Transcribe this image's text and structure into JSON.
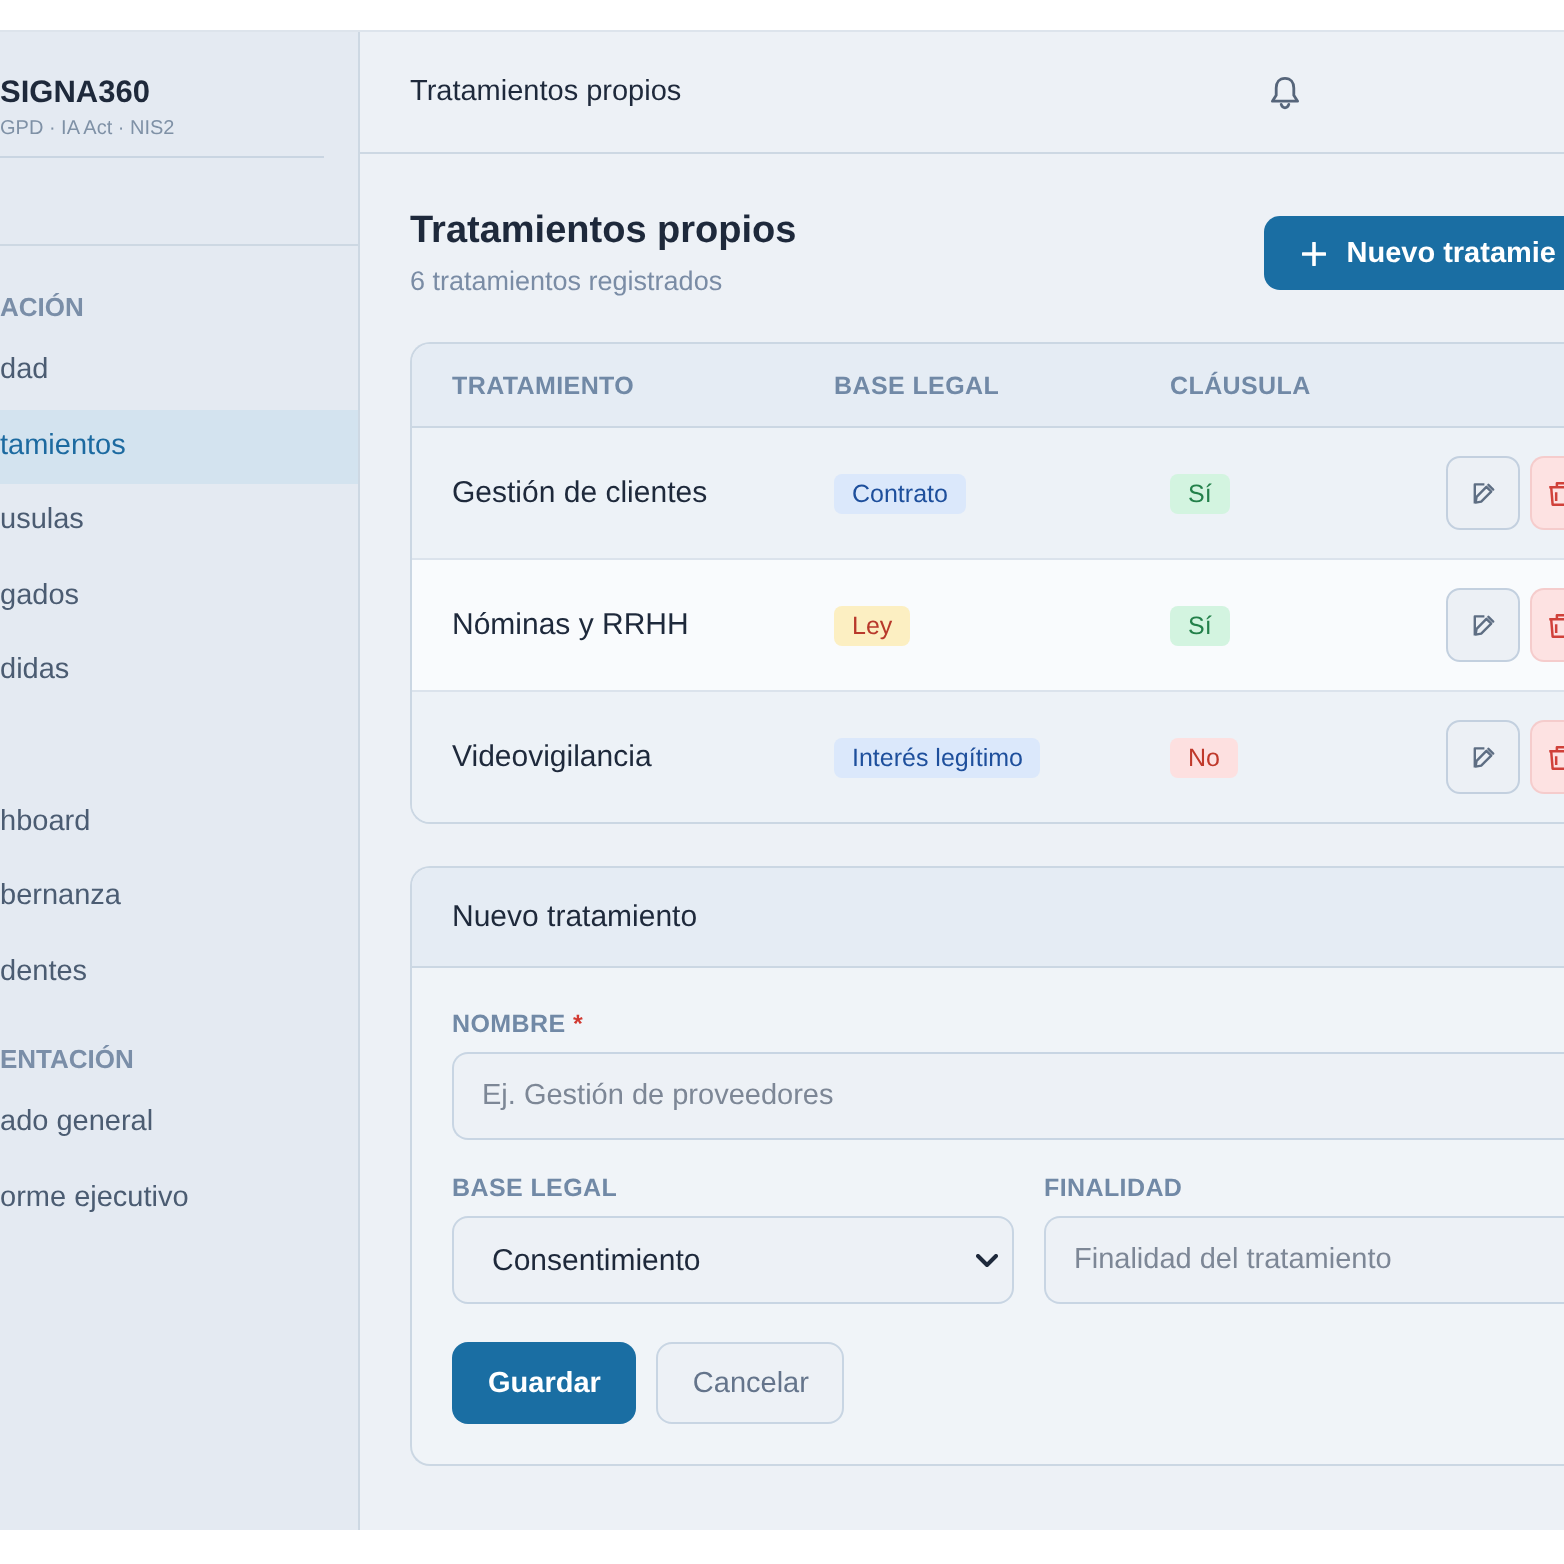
{
  "sidebar": {
    "brand": "SIGNA360",
    "tagline": "GPD · IA Act · NIS2",
    "sections": [
      {
        "title": "ACIÓN",
        "items": [
          {
            "label": "dad",
            "selected": false
          },
          {
            "label": "tamientos",
            "selected": true
          },
          {
            "label": "usulas",
            "selected": false
          },
          {
            "label": "gados",
            "selected": false
          },
          {
            "label": "didas",
            "selected": false
          }
        ]
      },
      {
        "items": [
          {
            "label": "hboard",
            "selected": false
          },
          {
            "label": "bernanza",
            "selected": false
          },
          {
            "label": "dentes",
            "selected": false
          }
        ]
      },
      {
        "title": "ENTACIÓN",
        "items": [
          {
            "label": "ado general",
            "selected": false
          },
          {
            "label": "orme ejecutivo",
            "selected": false
          }
        ]
      }
    ]
  },
  "topbar": {
    "title": "Tratamientos propios"
  },
  "page": {
    "title": "Tratamientos propios",
    "subtitle": "6 tratamientos registrados",
    "new_button": "Nuevo tratamie"
  },
  "table": {
    "columns": [
      "TRATAMIENTO",
      "BASE LEGAL",
      "CLÁUSULA"
    ],
    "rows": [
      {
        "name": "Gestión de clientes",
        "legal_basis": {
          "label": "Contrato",
          "kind": "info"
        },
        "clause": {
          "label": "Sí",
          "positive": true
        },
        "highlighted": false
      },
      {
        "name": "Nóminas y RRHH",
        "legal_basis": {
          "label": "Ley",
          "kind": "warning"
        },
        "clause": {
          "label": "Sí",
          "positive": true
        },
        "highlighted": true
      },
      {
        "name": "Videovigilancia",
        "legal_basis": {
          "label": "Interés legítimo",
          "kind": "info"
        },
        "clause": {
          "label": "No",
          "positive": false
        },
        "highlighted": false
      }
    ]
  },
  "form": {
    "title": "Nuevo tratamiento",
    "name": {
      "label": "NOMBRE",
      "required_mark": "*",
      "placeholder": "Ej. Gestión de proveedores"
    },
    "legal_basis": {
      "label": "BASE LEGAL",
      "value": "Consentimiento"
    },
    "purpose": {
      "label": "FINALIDAD",
      "placeholder": "Finalidad del tratamiento"
    },
    "buttons": [
      {
        "label": "Guardar",
        "kind": "primary"
      },
      {
        "label": "Cancelar",
        "kind": "secondary"
      }
    ]
  }
}
